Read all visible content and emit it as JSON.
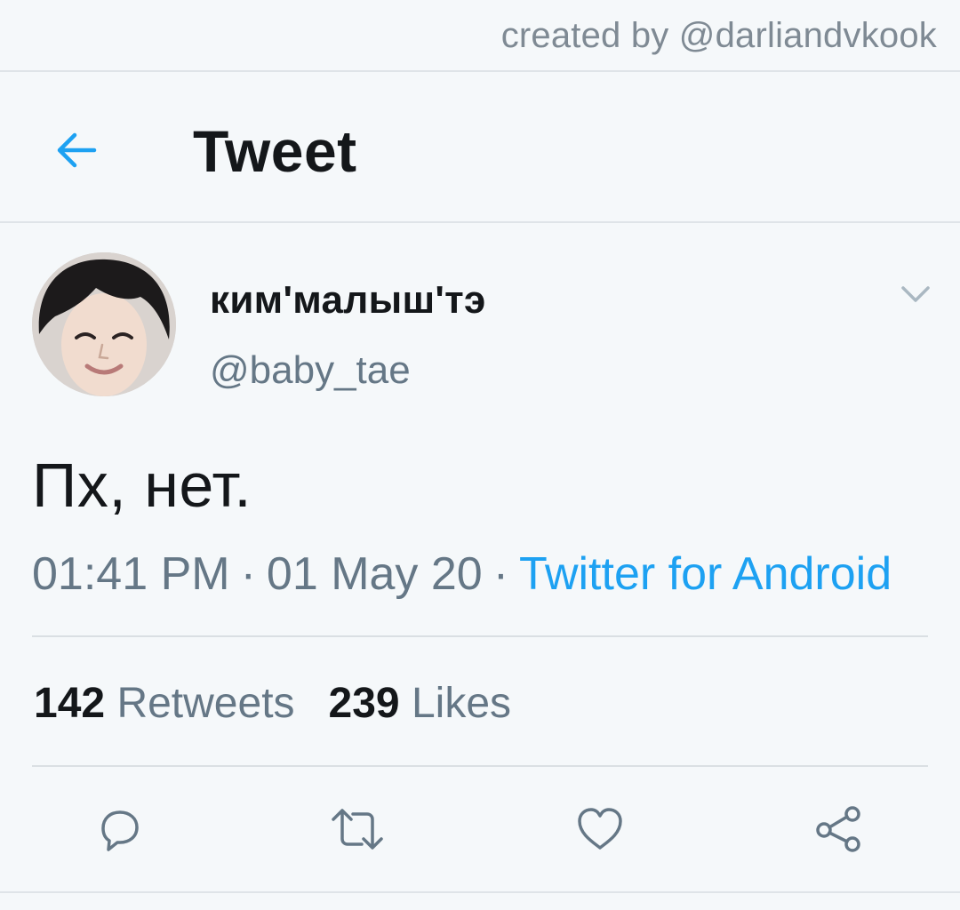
{
  "watermark": "created by @darliandvkook",
  "header": {
    "title": "Tweet",
    "back_icon": "arrow-left-icon"
  },
  "tweet": {
    "display_name": "ким'малыш'тэ",
    "handle": "@baby_tae",
    "text": "Пх, нет.",
    "time": "01:41 PM",
    "date": "01 May 20",
    "separator": "·",
    "source": "Twitter for Android",
    "retweets_count": "142",
    "retweets_label": "Retweets",
    "likes_count": "239",
    "likes_label": "Likes"
  },
  "actions": [
    "reply-icon",
    "retweet-icon",
    "like-icon",
    "share-icon"
  ],
  "colors": {
    "accent": "#1da1f2",
    "secondary_text": "#657786",
    "primary_text": "#14171a",
    "background": "#f5f8fa",
    "divider": "#dfe4e8"
  }
}
